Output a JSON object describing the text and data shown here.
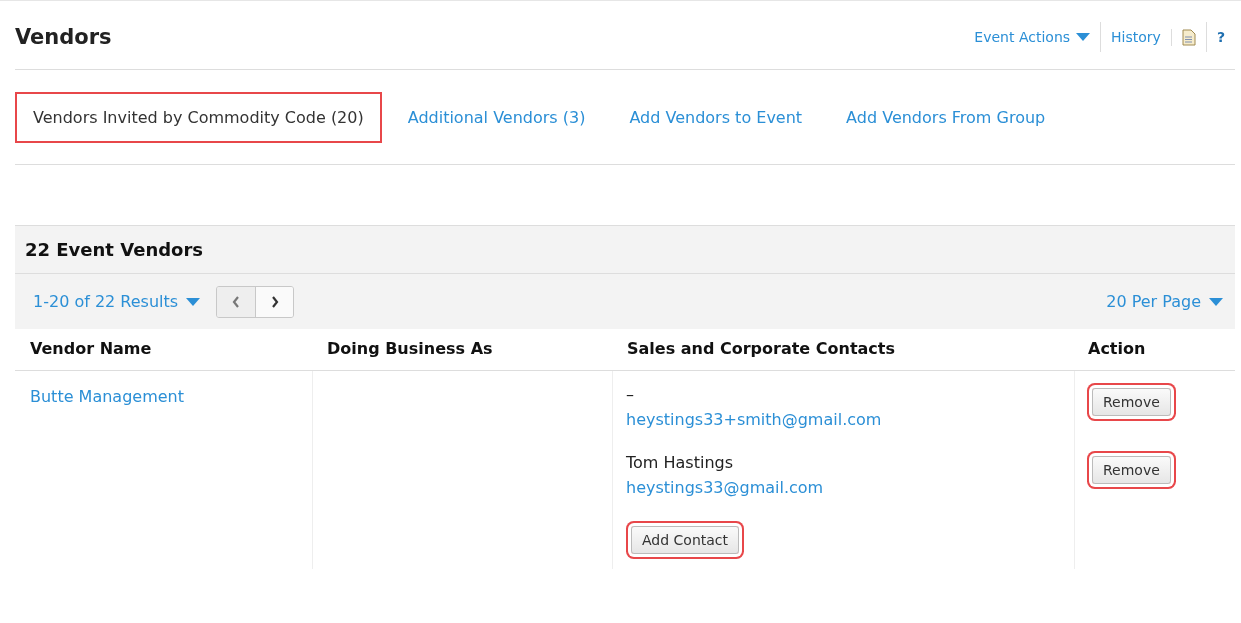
{
  "header": {
    "title": "Vendors",
    "actions": [
      {
        "kind": "menu",
        "label": "Event Actions"
      },
      {
        "kind": "link",
        "label": "History"
      },
      {
        "kind": "document-icon"
      },
      {
        "kind": "text",
        "label": "?"
      }
    ]
  },
  "tabs": [
    {
      "label": "Vendors Invited by Commodity Code (20)",
      "selected": true,
      "highlighted": true
    },
    {
      "label": "Additional Vendors (3)",
      "selected": false,
      "highlighted": false
    },
    {
      "label": "Add Vendors to Event",
      "selected": false,
      "highlighted": false
    },
    {
      "label": "Add Vendors From Group",
      "selected": false,
      "highlighted": false
    }
  ],
  "section": {
    "title": "22 Event Vendors",
    "results": "1-20 of 22 Results",
    "per_page": "20 Per Page",
    "prev_disabled": true
  },
  "table": {
    "columns": [
      "Vendor Name",
      "Doing Business As",
      "Sales and Corporate Contacts",
      "Action"
    ],
    "rows": [
      {
        "vendor": "Butte Management",
        "contacts": [
          {
            "name": "–",
            "email": "heystings33+smith@gmail.com",
            "action": "Remove",
            "highlighted": true
          },
          {
            "name": "Tom Hastings",
            "email": "heystings33@gmail.com",
            "action": "Remove",
            "highlighted": true
          }
        ],
        "add_contact": {
          "label": "Add Contact",
          "highlighted": true
        }
      }
    ]
  }
}
